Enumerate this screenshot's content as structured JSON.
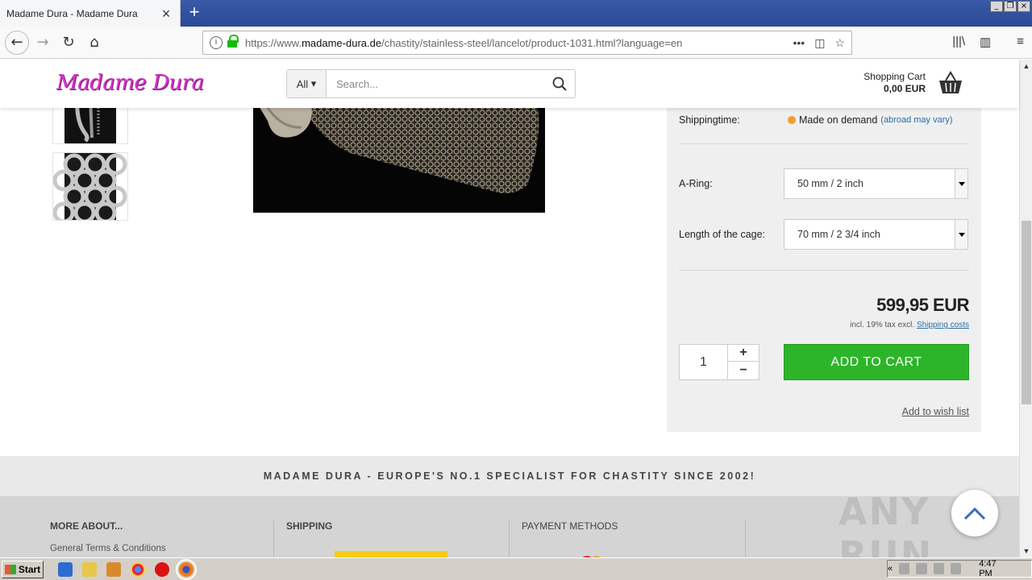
{
  "browser": {
    "tab_title": "Madame Dura - Madame Dura",
    "url_prefix": "https://www.",
    "url_domain": "madame-dura.de",
    "url_path": "/chastity/stainless-steel/lancelot/product-1031.html?language=en"
  },
  "header": {
    "logo": "Madame Dura",
    "search_category": "All",
    "search_placeholder": "Search...",
    "cart_label": "Shopping Cart",
    "cart_amount": "0,00 EUR"
  },
  "product": {
    "shipping_label": "Shippingtime:",
    "shipping_value": "Made on demand",
    "shipping_note": "(abroad may vary)",
    "ring_label": "A-Ring:",
    "ring_value": "50 mm / 2 inch",
    "length_label": "Length of the cage:",
    "length_value": "70 mm / 2 3/4 inch",
    "price": "599,95 EUR",
    "tax_text": "incl. 19% tax excl.",
    "shipping_costs_link": "Shipping costs",
    "quantity": "1",
    "add_to_cart": "ADD TO CART",
    "wish_list": "Add to wish list"
  },
  "banner": "MADAME DURA - EUROPE'S NO.1 SPECIALIST FOR CHASTITY SINCE 2002!",
  "footer": {
    "col1_heading": "MORE ABOUT...",
    "col1_link": "General Terms & Conditions",
    "col2_heading": "SHIPPING",
    "col3_heading": "PAYMENT METHODS"
  },
  "watermark": "ANY RUN",
  "taskbar": {
    "start_label": "Start",
    "time": "4:47 PM"
  }
}
